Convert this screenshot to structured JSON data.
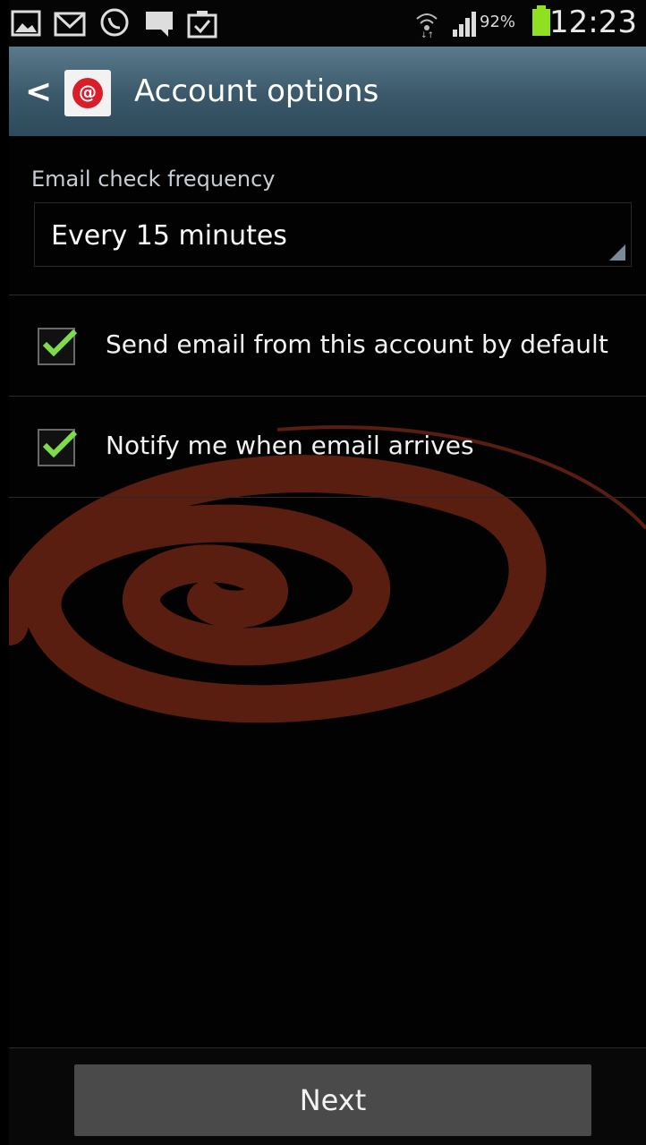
{
  "status_bar": {
    "icons": [
      "gallery-icon",
      "gmail-icon",
      "whatsapp-icon",
      "message-icon",
      "task-icon",
      "wifi-icon",
      "signal-icon",
      "battery-icon"
    ],
    "battery_percent": "92%",
    "time": "12:23"
  },
  "action_bar": {
    "title": "Account options"
  },
  "settings": {
    "frequency_label": "Email check frequency",
    "frequency_value": "Every 15 minutes",
    "options": [
      {
        "label": "Send email from this account by default",
        "checked": true
      },
      {
        "label": "Notify me when email arrives",
        "checked": true
      }
    ]
  },
  "footer": {
    "next_label": "Next"
  },
  "colors": {
    "action_bar": "#3a586a",
    "checkmark": "#7ddc4a",
    "battery": "#8ee020",
    "swirl": "#5a1e10"
  }
}
